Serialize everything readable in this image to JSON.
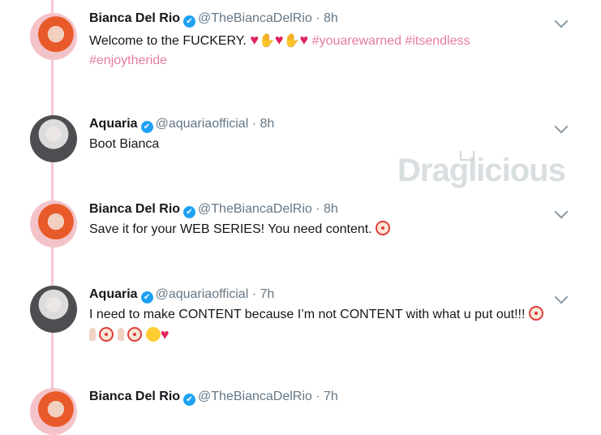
{
  "tweets": [
    {
      "name": "Bianca Del Rio",
      "handle": "@TheBiancaDelRio",
      "time": "8h",
      "text": "Welcome to the FUCKERY.",
      "hashtags": [
        "#youarewarned",
        "#itsendless",
        "#enjoytheride"
      ]
    },
    {
      "name": "Aquaria",
      "handle": "@aquariaofficial",
      "time": "8h",
      "text": "Boot Bianca"
    },
    {
      "name": "Bianca Del Rio",
      "handle": "@TheBiancaDelRio",
      "time": "8h",
      "text": "Save it for your WEB SERIES! You need content."
    },
    {
      "name": "Aquaria",
      "handle": "@aquariaofficial",
      "time": "7h",
      "text": "I need to make CONTENT because I’m not CONTENT with what u put out!!!"
    },
    {
      "name": "Bianca Del Rio",
      "handle": "@TheBiancaDelRio",
      "time": "7h"
    }
  ],
  "separator": "·",
  "watermark": "Draglicious",
  "colors": {
    "hashtag": "#e57da1",
    "thread_line": "#f6c4d4",
    "verified": "#1da1f2",
    "heart": "#e0245e"
  }
}
